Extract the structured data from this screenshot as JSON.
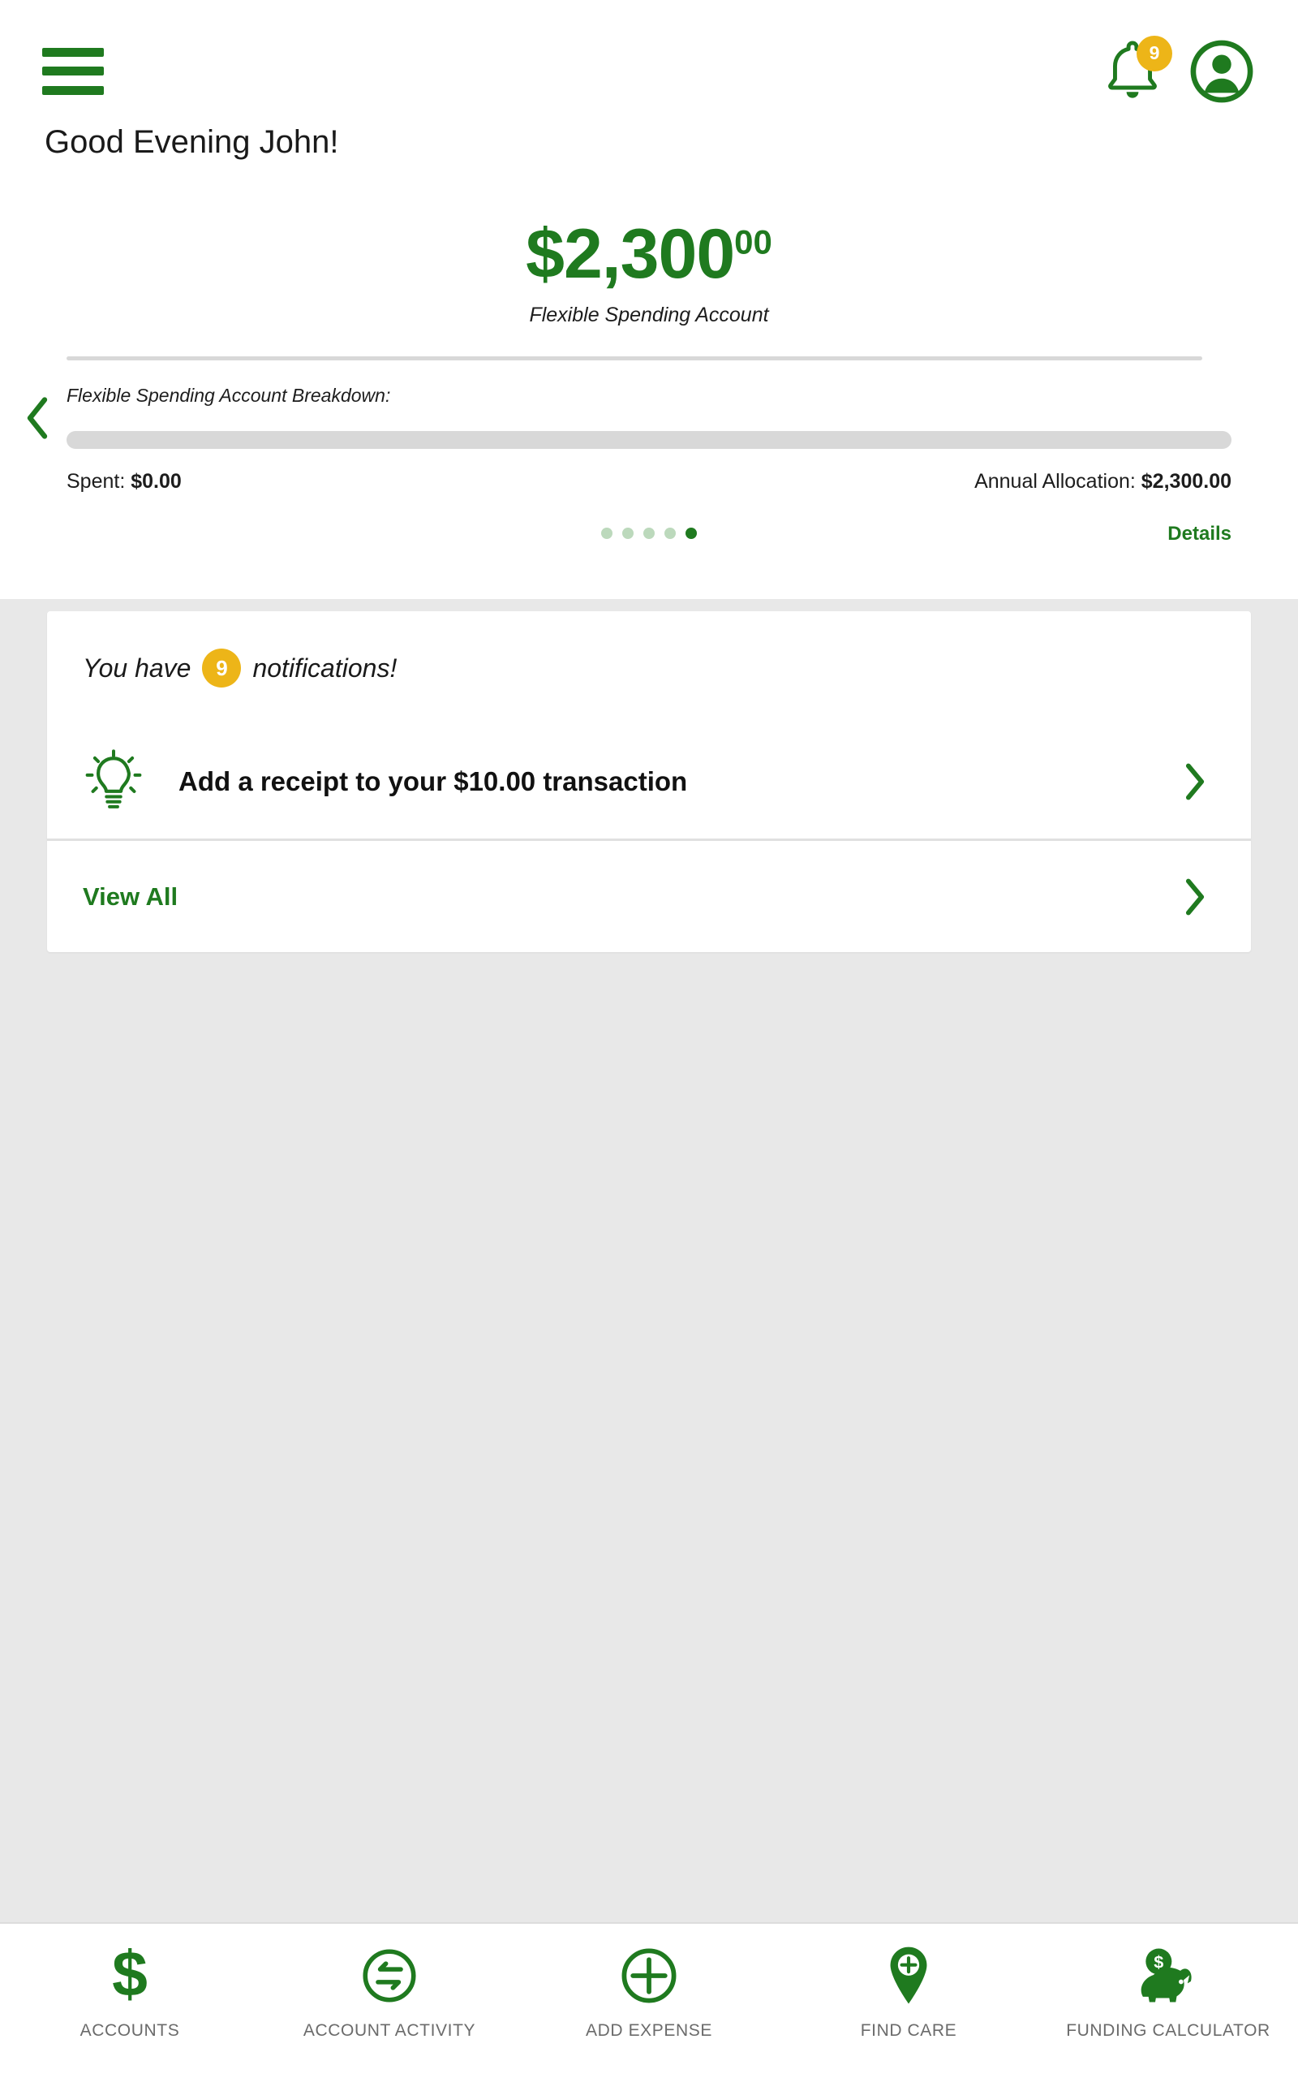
{
  "theme": {
    "brand_green": "#1f7a1f",
    "badge_yellow": "#edb518",
    "page_background": "#e8e8e8",
    "card_background": "#ffffff",
    "track_gray": "#d8d8d8"
  },
  "appbar": {
    "menu_icon": "hamburger-menu-icon",
    "bell_icon": "notification-bell-icon",
    "bell_badge_count": "9",
    "avatar_icon": "user-avatar-icon"
  },
  "greeting": {
    "text": "Good Evening John!"
  },
  "balance": {
    "dollars": "$2,300",
    "cents": "00",
    "account_label": "Flexible Spending Account",
    "prev_icon": "chevron-left-icon"
  },
  "breakdown": {
    "title": "Flexible Spending Account Breakdown:",
    "spent_label": "Spent:",
    "spent_value": "$0.00",
    "allocation_label": "Annual Allocation:",
    "allocation_value": "$2,300.00",
    "progress_percent": 0
  },
  "carousel": {
    "dot_count": 5,
    "active_index": 4,
    "details_label": "Details"
  },
  "notifications": {
    "header_prefix": "You have",
    "header_count": "9",
    "header_suffix": "notifications!",
    "items": [
      {
        "icon": "lightbulb-idea-icon",
        "text": "Add a receipt to your $10.00 transaction",
        "chevron": "chevron-right-icon"
      }
    ],
    "view_all_label": "View All",
    "view_all_chevron": "chevron-right-icon"
  },
  "bottom_nav": {
    "items": [
      {
        "label": "ACCOUNTS",
        "icon": "dollar-sign-icon"
      },
      {
        "label": "ACCOUNT ACTIVITY",
        "icon": "exchange-arrows-circle-icon"
      },
      {
        "label": "ADD EXPENSE",
        "icon": "plus-circle-icon"
      },
      {
        "label": "FIND CARE",
        "icon": "map-pin-plus-icon"
      },
      {
        "label": "FUNDING CALCULATOR",
        "icon": "piggy-bank-icon"
      }
    ]
  }
}
